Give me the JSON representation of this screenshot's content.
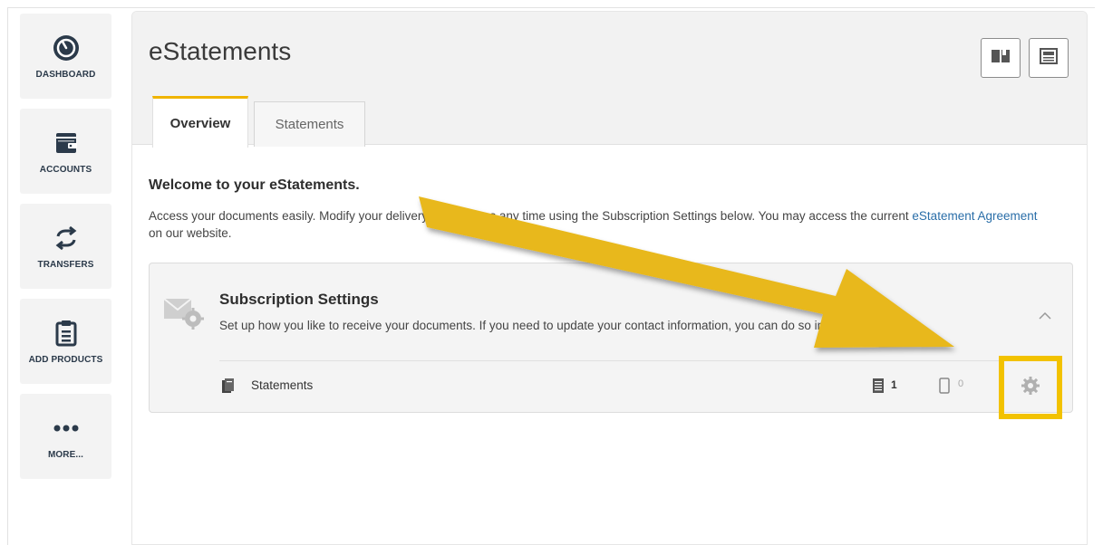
{
  "sidebar": {
    "items": [
      {
        "label": "DASHBOARD",
        "icon": "speedometer-icon"
      },
      {
        "label": "ACCOUNTS",
        "icon": "wallet-icon"
      },
      {
        "label": "TRANSFERS",
        "icon": "transfer-arrows-icon"
      },
      {
        "label": "ADD PRODUCTS",
        "icon": "clipboard-icon"
      },
      {
        "label": "MORE...",
        "icon": "more-dots-icon"
      }
    ]
  },
  "header": {
    "title": "eStatements",
    "buttons": [
      "book-icon",
      "newspaper-icon"
    ]
  },
  "tabs": [
    {
      "label": "Overview",
      "active": true
    },
    {
      "label": "Statements",
      "active": false
    }
  ],
  "content": {
    "welcome": "Welcome to your eStatements.",
    "desc_before_link": "Access your documents easily. Modify your delivery preferences any time using the Subscription Settings below. You may access the current ",
    "link_text": "eStatement Agreement",
    "desc_after_link": " on our website."
  },
  "subscription": {
    "title": "Subscription Settings",
    "subtitle": "Set up how you like to receive your documents. If you need to update your contact information, you can do so in Settings.",
    "row": {
      "label": "Statements",
      "paper_count": "1",
      "device_count": "0"
    }
  },
  "colors": {
    "accent": "#f0b400",
    "annotation": "#f2c200",
    "link": "#2a6ea8",
    "nav_label": "#2b3a4a"
  }
}
